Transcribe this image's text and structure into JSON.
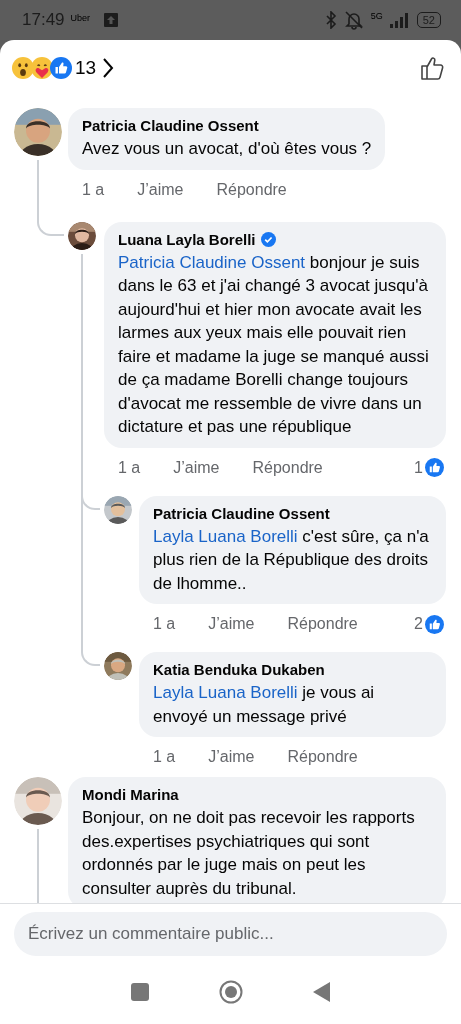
{
  "status_bar": {
    "time": "17:49",
    "app_label": "Uber",
    "network": "5G",
    "battery": "52"
  },
  "reactions": {
    "icons": [
      {
        "kind": "wow"
      },
      {
        "kind": "care"
      },
      {
        "kind": "like"
      }
    ],
    "count": "13"
  },
  "comments": [
    {
      "author": "Patricia Claudine Ossent",
      "verified": false,
      "text": "Avez vous  un avocat,  d'où êtes vous ?",
      "time": "1 a",
      "like": "J’aime",
      "reply": "Répondre",
      "has_replies": true,
      "children": [
        {
          "author": "Luana Layla Borelli",
          "verified": true,
          "mention": "Patricia Claudine Ossent",
          "text": "bonjour je suis dans le 63 et j'ai changé 3 avocat jusqu'à aujourd'hui et hier mon avocate avait les larmes aux yeux mais  elle pouvait rien faire et madame la juge se manqué aussi de ça madame Borelli change toujours d'avocat me ressemble de vivre dans un dictature et pas une république",
          "time": "1 a",
          "like": "J’aime",
          "reply": "Répondre",
          "likes": "1",
          "has_replies": true,
          "children": [
            {
              "author": "Patricia Claudine Ossent",
              "verified": false,
              "mention": "Layla Luana Borelli",
              "text": "c'est sûre, ça n'a plus rien de la République des droits de lhomme..",
              "time": "1 a",
              "like": "J’aime",
              "reply": "Répondre",
              "likes": "2",
              "has_replies": false
            },
            {
              "author": "Katia Benduka Dukaben",
              "verified": false,
              "mention": "Layla Luana Borelli",
              "text": "je vous ai envoyé un message privé",
              "time": "1 a",
              "like": "J’aime",
              "reply": "Répondre",
              "has_replies": false
            }
          ]
        }
      ]
    },
    {
      "author": "Mondi Marina",
      "verified": false,
      "text": "Bonjour, on ne doit pas recevoir les rapports des.expertises psychiatriques qui sont ordonnés par le juge mais on peut  les consulter auprès du tribunal.",
      "has_replies": true
    }
  ],
  "composer": {
    "placeholder": "Écrivez un commentaire public..."
  }
}
